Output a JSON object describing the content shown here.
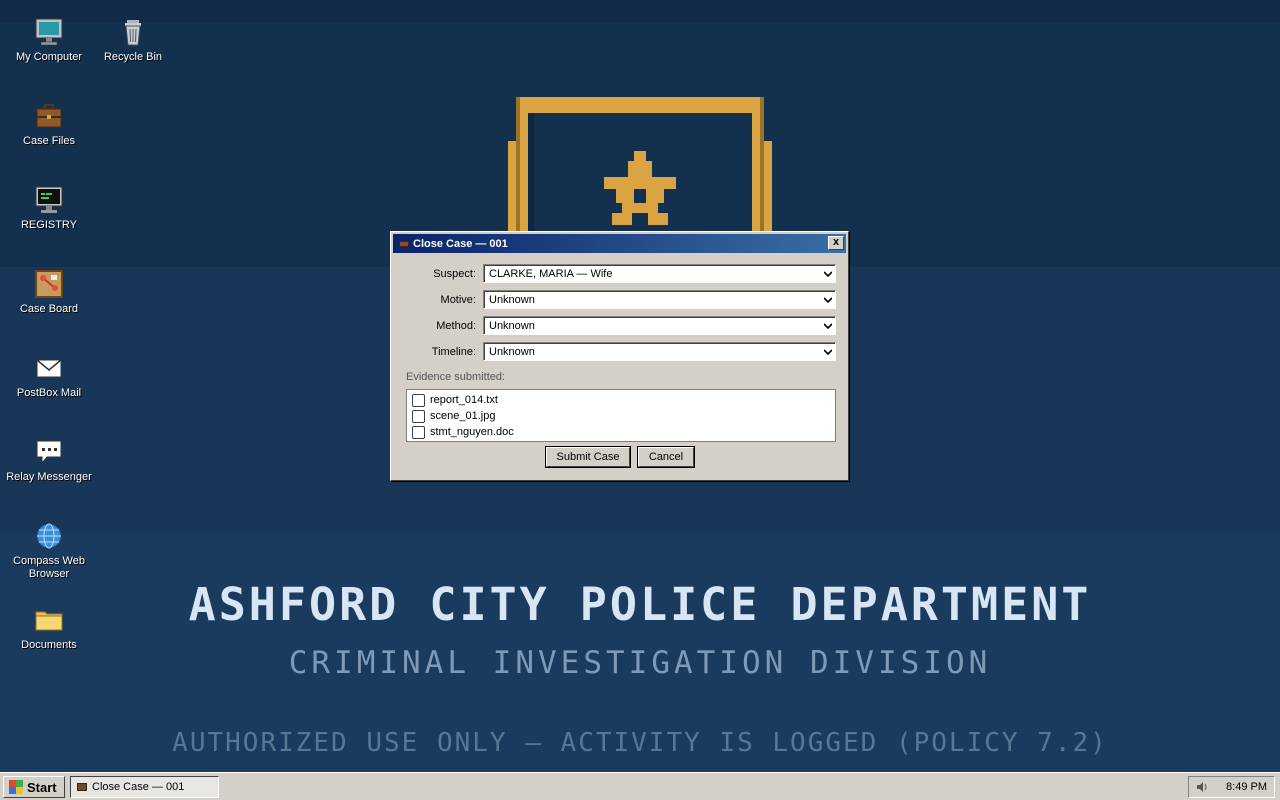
{
  "desktop": {
    "icons": [
      {
        "label": "My Computer",
        "icon": "monitor-icon"
      },
      {
        "label": "Recycle Bin",
        "icon": "trash-icon"
      },
      {
        "label": "Case Files",
        "icon": "briefcase-icon"
      },
      {
        "label": "REGISTRY",
        "icon": "terminal-icon"
      },
      {
        "label": "Case Board",
        "icon": "pinboard-icon"
      },
      {
        "label": "PostBox Mail",
        "icon": "envelope-icon"
      },
      {
        "label": "Relay Messenger",
        "icon": "chat-bubble-icon"
      },
      {
        "label": "Compass Web Browser",
        "icon": "globe-icon"
      },
      {
        "label": "Documents",
        "icon": "folder-icon"
      }
    ],
    "banner": {
      "title": "ASHFORD CITY POLICE DEPARTMENT",
      "subtitle": "CRIMINAL INVESTIGATION DIVISION",
      "warning": "AUTHORIZED USE ONLY — ACTIVITY IS LOGGED (POLICY 7.2)"
    }
  },
  "dialog": {
    "title": "Close Case — 001",
    "close_label": "x",
    "fields": [
      {
        "label": "Suspect:",
        "value": "CLARKE, MARIA — Wife"
      },
      {
        "label": "Motive:",
        "value": "Unknown"
      },
      {
        "label": "Method:",
        "value": "Unknown"
      },
      {
        "label": "Timeline:",
        "value": "Unknown"
      }
    ],
    "evidence_label": "Evidence submitted:",
    "evidence": [
      {
        "name": "report_014.txt",
        "checked": false
      },
      {
        "name": "scene_01.jpg",
        "checked": false
      },
      {
        "name": "stmt_nguyen.doc",
        "checked": false
      }
    ],
    "submit_label": "Submit Case",
    "cancel_label": "Cancel"
  },
  "taskbar": {
    "start_label": "Start",
    "task_label": "Close Case — 001",
    "clock": "8:49 PM"
  },
  "colors": {
    "desktop_bg": "#173253",
    "badge_gold": "#d9a441",
    "badge_navy": "#14304f",
    "titlebar_start": "#0a246a",
    "titlebar_end": "#3a6ea5"
  }
}
